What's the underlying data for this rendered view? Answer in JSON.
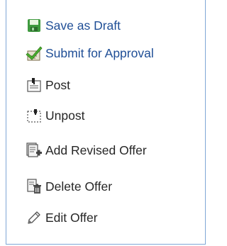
{
  "menu": {
    "items": [
      {
        "label": "Save as Draft",
        "icon": "floppy-disk-icon"
      },
      {
        "label": "Submit for Approval",
        "icon": "document-checkmark-icon"
      },
      {
        "label": "Post",
        "icon": "post-note-icon"
      },
      {
        "label": "Unpost",
        "icon": "unpost-note-icon"
      },
      {
        "label": "Add Revised Offer",
        "icon": "document-add-icon"
      },
      {
        "label": "Delete Offer",
        "icon": "document-trash-icon"
      },
      {
        "label": "Edit Offer",
        "icon": "pencil-icon"
      }
    ]
  },
  "colors": {
    "link_text": "#1f4e96",
    "plain_text": "#262626",
    "border": "#7fa7d6",
    "save_icon": "#3f9a3f",
    "check_icon": "#4caf2f"
  }
}
